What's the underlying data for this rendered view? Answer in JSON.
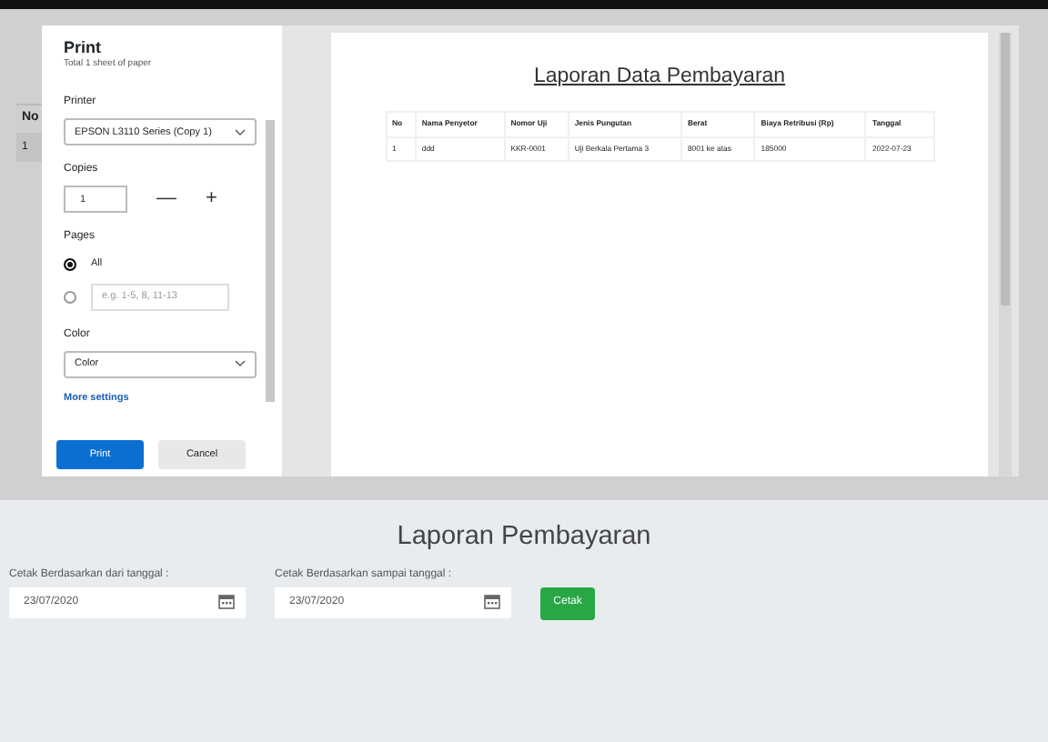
{
  "background_table": {
    "header": "No",
    "cell": "1"
  },
  "print_dialog": {
    "title": "Print",
    "summary": "Total 1 sheet of paper",
    "printer": {
      "label": "Printer",
      "value": "EPSON L3110 Series (Copy 1)"
    },
    "copies": {
      "label": "Copies",
      "value": "1",
      "minus": "—",
      "plus": "+"
    },
    "pages": {
      "label": "Pages",
      "options": [
        {
          "kind": "plain",
          "label": "All",
          "selected": true
        },
        {
          "kind": "range",
          "placeholder": "e.g. 1-5, 8, 11-13",
          "selected": false
        }
      ]
    },
    "color": {
      "label": "Color",
      "value": "Color"
    },
    "more_settings": "More settings",
    "buttons": [
      {
        "label": "Print",
        "kind": "primary"
      },
      {
        "label": "Cancel",
        "kind": "secondary"
      }
    ]
  },
  "preview": {
    "title": "Laporan Data Pembayaran",
    "columns": [
      "No",
      "Nama Penyetor",
      "Nomor Uji",
      "Jenis Pungutan",
      "Berat",
      "Biaya Retribusi (Rp)",
      "Tanggal"
    ],
    "rows": [
      [
        "1",
        "ddd",
        "KKR-0001",
        "Uji Berkala Pertama 3",
        "8001 ke atas",
        "185000",
        "2022-07-23"
      ]
    ]
  },
  "report": {
    "heading": "Laporan Pembayaran",
    "fields": [
      {
        "label": "Cetak Berdasarkan dari tanggal :",
        "value": "23/07/2020"
      },
      {
        "label": "Cetak Berdasarkan sampai tanggal :",
        "value": "23/07/2020"
      }
    ],
    "button": "Cetak"
  }
}
